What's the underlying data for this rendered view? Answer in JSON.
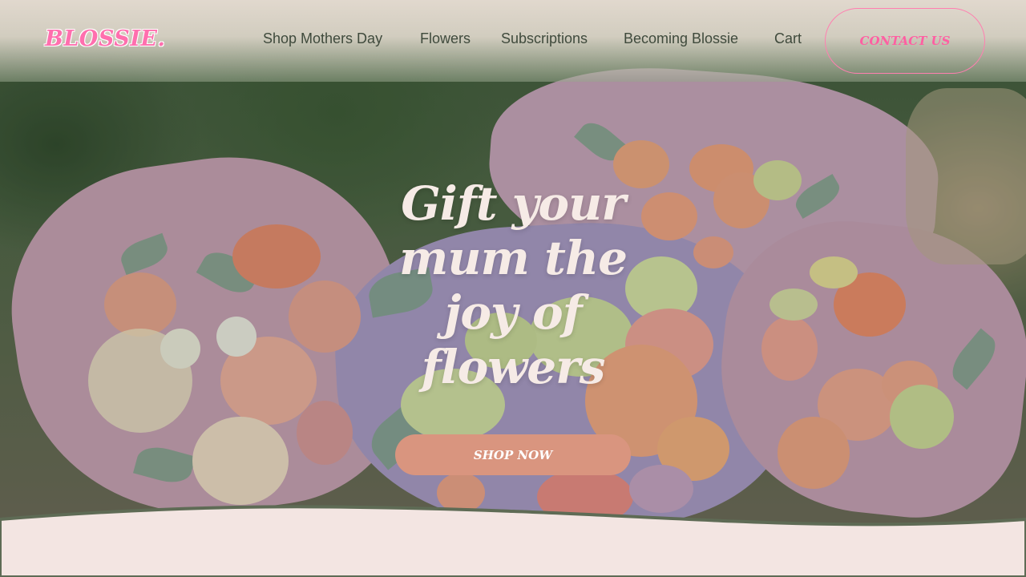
{
  "brand": {
    "logo_text": "BLOSSIE."
  },
  "nav": {
    "links": [
      {
        "label": "Shop Mothers Day"
      },
      {
        "label": "Flowers"
      },
      {
        "label": "Subscriptions"
      },
      {
        "label": "Becoming Blossie"
      },
      {
        "label": "Cart"
      }
    ],
    "contact_label": "CONTACT US"
  },
  "hero": {
    "headline_lines": [
      "Gift your",
      "mum the",
      "joy of",
      "flowers"
    ],
    "cta_label": "SHOP NOW"
  },
  "colors": {
    "brand_pink": "#ff6fae",
    "cta_peach": "#d9957f",
    "page_bg": "#f3e5e2",
    "wave_border": "#5e6b55"
  }
}
